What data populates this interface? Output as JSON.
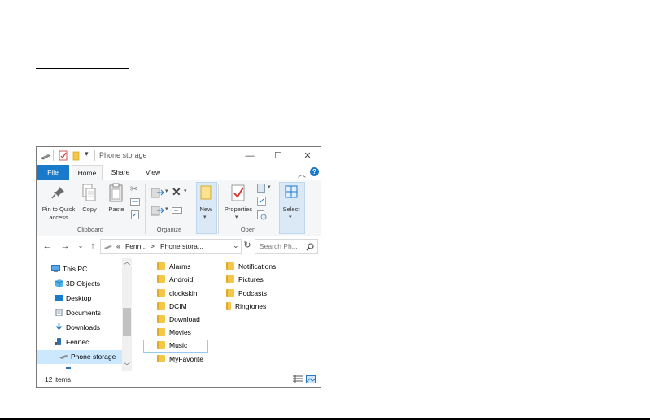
{
  "window": {
    "title": "Phone storage",
    "tabs": [
      "File",
      "Home",
      "Share",
      "View"
    ],
    "active_tab": "Home"
  },
  "ribbon": {
    "clipboard": {
      "pin_label_line1": "Pin to Quick",
      "pin_label_line2": "access",
      "copy_label": "Copy",
      "paste_label": "Paste",
      "group_label": "Clipboard"
    },
    "organize": {
      "group_label": "Organize"
    },
    "new": {
      "new_label": "New",
      "group_label": ""
    },
    "open": {
      "properties_label": "Properties",
      "group_label": "Open"
    },
    "select": {
      "select_label": "Select"
    }
  },
  "address": {
    "overflow": "«",
    "segments": [
      "Fenn...",
      "Phone stora..."
    ],
    "search_placeholder": "Search Ph..."
  },
  "nav_pane": {
    "items": [
      {
        "label": "This PC",
        "icon": "pc-icon"
      },
      {
        "label": "3D Objects",
        "icon": "cube-icon"
      },
      {
        "label": "Desktop",
        "icon": "desktop-icon"
      },
      {
        "label": "Documents",
        "icon": "documents-icon"
      },
      {
        "label": "Downloads",
        "icon": "download-icon"
      },
      {
        "label": "Fennec",
        "icon": "phone-icon"
      },
      {
        "label": "Phone storage",
        "icon": "drive-icon"
      }
    ],
    "selected": "Phone storage"
  },
  "files": {
    "col1": [
      "Alarms",
      "Android",
      "clockskin",
      "DCIM",
      "Download",
      "Movies",
      "Music",
      "MyFavorite"
    ],
    "col2": [
      "Notifications",
      "Pictures",
      "Podcasts",
      "Ringtones"
    ],
    "focused": "Music"
  },
  "status": {
    "item_count": "12 items"
  },
  "colors": {
    "file_tab": "#1979ca",
    "selection": "#cce8ff",
    "folder": "#f3c74a"
  }
}
